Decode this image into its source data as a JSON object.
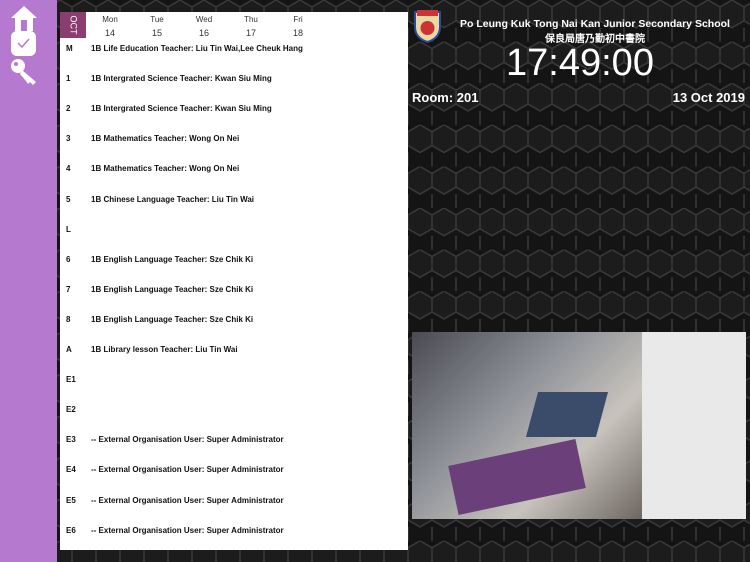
{
  "sidebar": {
    "items": [
      {
        "icon": "home-icon"
      },
      {
        "icon": "check-icon"
      },
      {
        "icon": "key-icon"
      }
    ]
  },
  "calendar": {
    "month": "OCT",
    "days": [
      {
        "name": "Mon",
        "date": "14"
      },
      {
        "name": "Tue",
        "date": "15"
      },
      {
        "name": "Wed",
        "date": "16"
      },
      {
        "name": "Thu",
        "date": "17"
      },
      {
        "name": "Fri",
        "date": "18"
      }
    ]
  },
  "schedule": [
    {
      "period": "M",
      "text": "1B Life Education  Teacher: Liu Tin Wai,Lee Cheuk Hang"
    },
    {
      "period": "1",
      "text": "1B Intergrated Science  Teacher: Kwan Siu Ming"
    },
    {
      "period": "2",
      "text": "1B Intergrated Science  Teacher: Kwan Siu Ming"
    },
    {
      "period": "3",
      "text": "1B Mathematics  Teacher: Wong On Nei"
    },
    {
      "period": "4",
      "text": "1B Mathematics  Teacher: Wong On Nei"
    },
    {
      "period": "5",
      "text": "1B Chinese Language  Teacher: Liu Tin Wai"
    },
    {
      "period": "L",
      "text": ""
    },
    {
      "period": "6",
      "text": "1B English Language  Teacher: Sze Chik Ki"
    },
    {
      "period": "7",
      "text": "1B English Language  Teacher: Sze Chik Ki"
    },
    {
      "period": "8",
      "text": "1B English Language  Teacher: Sze Chik Ki"
    },
    {
      "period": "A",
      "text": "1B Library lesson  Teacher: Liu Tin Wai"
    },
    {
      "period": "E1",
      "text": ""
    },
    {
      "period": "E2",
      "text": ""
    },
    {
      "period": "E3",
      "text": "-- External Organisation  User: Super Administrator"
    },
    {
      "period": "E4",
      "text": "-- External Organisation  User: Super Administrator"
    },
    {
      "period": "E5",
      "text": "-- External Organisation  User: Super Administrator"
    },
    {
      "period": "E6",
      "text": "-- External Organisation  User: Super Administrator"
    }
  ],
  "header": {
    "school_en": "Po Leung Kuk Tong Nai Kan Junior Secondary School",
    "school_zh": "保良局唐乃勤初中書院",
    "time": "17:49:00",
    "room": "Room:  201",
    "date": "13 Oct 2019"
  },
  "colors": {
    "sidebar": "#b57ad0",
    "month": "#8a3d6e"
  }
}
